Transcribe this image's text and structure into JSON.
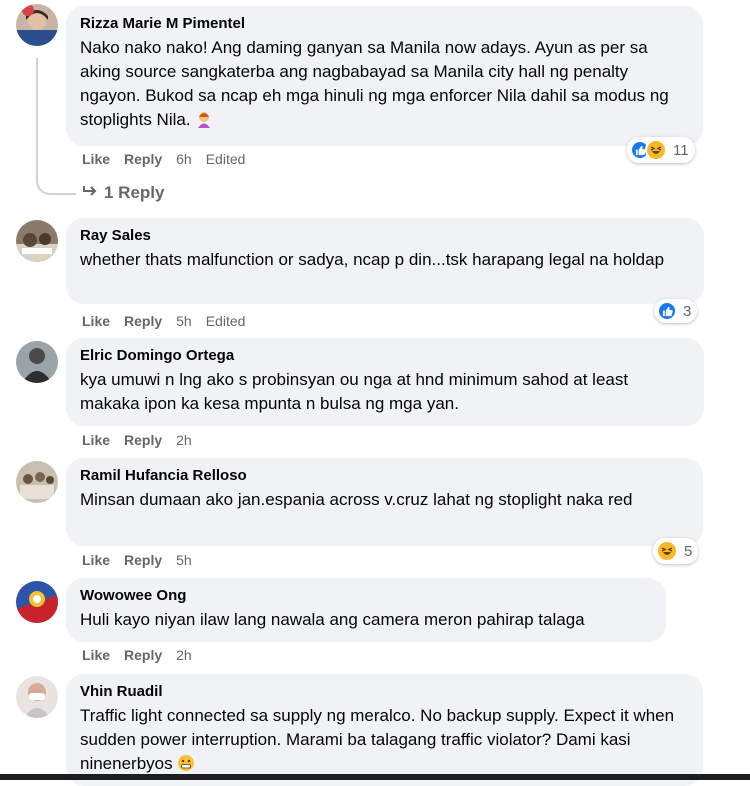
{
  "comments": [
    {
      "author": "Rizza Marie M Pimentel",
      "text": "Nako nako nako! Ang daming ganyan sa Manila now adays. Ayun as per sa aking source sangkaterba ang nagbabayad sa Manila city hall ng penalty ngayon. Bukod sa ncap eh mga hinuli ng mga enforcer Nila dahil sa modus ng stoplights Nila.",
      "like": "Like",
      "reply": "Reply",
      "time": "6h",
      "edited": "Edited",
      "reaction_count": "11"
    },
    {
      "author": "Ray Sales",
      "text": "whether thats malfunction or sadya, ncap p din...tsk harapang legal na holdap",
      "like": "Like",
      "reply": "Reply",
      "time": "5h",
      "edited": "Edited",
      "reaction_count": "3"
    },
    {
      "author": "Elric Domingo Ortega",
      "text": "kya umuwi n lng ako s probinsyan ou nga at hnd minimum sahod at least makaka ipon ka kesa mpunta n bulsa ng mga yan.",
      "like": "Like",
      "reply": "Reply",
      "time": "2h"
    },
    {
      "author": "Ramil Hufancia Relloso",
      "text": "Minsan dumaan ako jan.espania across v.cruz lahat ng stoplight naka red",
      "like": "Like",
      "reply": "Reply",
      "time": "5h",
      "reaction_count": "5"
    },
    {
      "author": "Wowowee Ong",
      "text": "Huli kayo niyan ilaw lang nawala ang camera meron pahirap talaga",
      "like": "Like",
      "reply": "Reply",
      "time": "2h"
    },
    {
      "author": "Vhin Ruadil",
      "text": "Traffic light connected sa supply ng meralco. No backup supply. Expect it when sudden power interruption. Marami ba talagang traffic violator? Dami kasi ninenerbyos"
    }
  ],
  "replies_link": "1 Reply",
  "colors": {
    "like_blue": "#1877f2",
    "haha_yellow": "#f7b928",
    "bubble": "#f0f2f5",
    "meta_gray": "#65676b"
  }
}
